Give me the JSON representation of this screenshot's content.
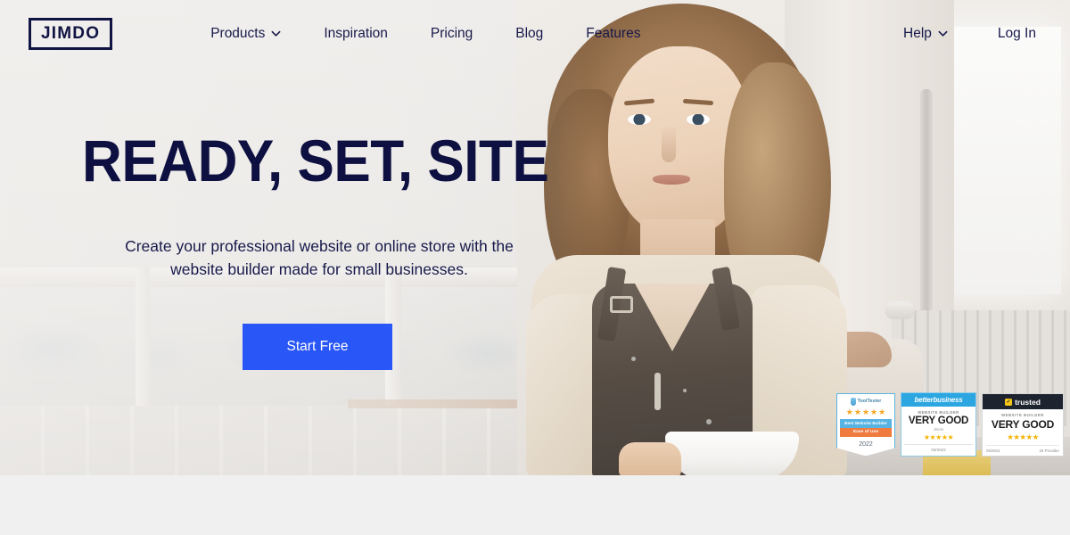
{
  "navbar": {
    "logo": "JIMDO",
    "links": [
      {
        "label": "Products",
        "icon": "chevron-down-icon",
        "has_chevron": true
      },
      {
        "label": "Inspiration",
        "has_chevron": false
      },
      {
        "label": "Pricing",
        "has_chevron": false
      },
      {
        "label": "Blog",
        "has_chevron": false
      },
      {
        "label": "Features",
        "has_chevron": false
      }
    ],
    "right": [
      {
        "label": "Help",
        "has_chevron": true
      },
      {
        "label": "Log In",
        "has_chevron": false
      }
    ]
  },
  "hero": {
    "headline": "READY, SET, SITE",
    "subheadline": "Create your professional website or online store with the website builder made for small businesses.",
    "cta_label": "Start Free",
    "cta_color": "#2956f7",
    "text_color": "#0d1040"
  },
  "badges": [
    {
      "id": "tooltester",
      "brand": "ToolTester",
      "stars": "★★★★★",
      "line1": "Best Website Builder",
      "line2": "Ease of Use",
      "year": "2022"
    },
    {
      "id": "better-business",
      "brand": "betterbusiness",
      "kicker": "WEBSITE BUILDER",
      "rating": "VERY GOOD",
      "subject": "Jimdo",
      "stars": "★★★★★",
      "date": "03/2022"
    },
    {
      "id": "trusted",
      "brand": "trusted",
      "check": "✓",
      "kicker": "WEBSITE BUILDER",
      "rating": "VERY GOOD",
      "stars": "★★★★★",
      "date": "05/2021",
      "providers": "26 Provider"
    }
  ]
}
